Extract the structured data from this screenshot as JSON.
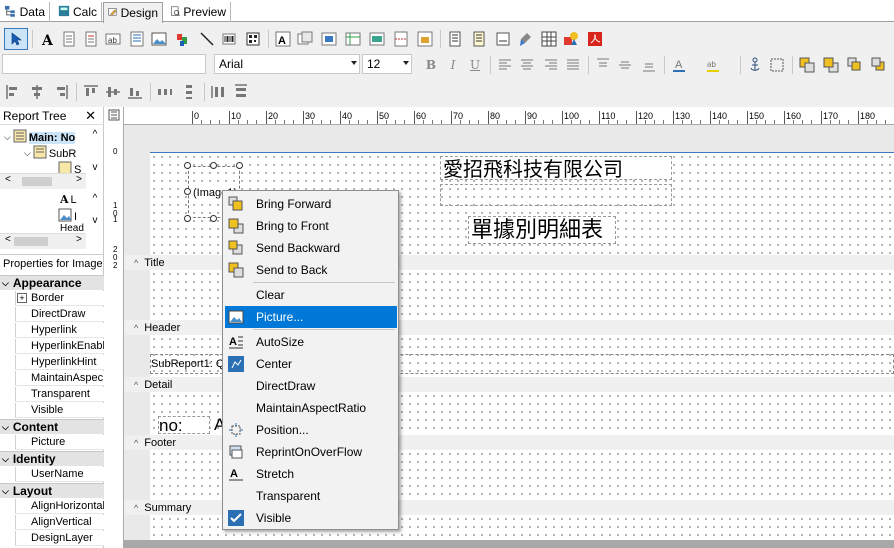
{
  "tabs": [
    {
      "label": "Data"
    },
    {
      "label": "Calc"
    },
    {
      "label": "Design"
    },
    {
      "label": "Preview"
    }
  ],
  "format_toolbar": {
    "font_name": "Arial",
    "font_size": "12"
  },
  "report_tree": {
    "title": "Report Tree",
    "items": [
      "Main: No",
      "SubR",
      "S",
      "L",
      "I",
      "Head"
    ]
  },
  "properties": {
    "title": "Properties for Image",
    "groups": [
      {
        "name": "Appearance",
        "items": [
          "Border",
          "DirectDraw",
          "Hyperlink",
          "HyperlinkEnabl",
          "HyperlinkHint",
          "MaintainAspec",
          "Transparent",
          "Visible"
        ]
      },
      {
        "name": "Content",
        "items": [
          "Picture"
        ]
      },
      {
        "name": "Identity",
        "items": [
          "UserName"
        ]
      },
      {
        "name": "Layout",
        "items": [
          "AlignHorizontal",
          "AlignVertical",
          "DesignLayer"
        ]
      }
    ]
  },
  "ruler_labels": [
    "0",
    "10",
    "20",
    "30",
    "40",
    "50",
    "60",
    "70",
    "80",
    "90",
    "100",
    "110",
    "120",
    "130",
    "140",
    "150",
    "160",
    "170",
    "180"
  ],
  "vruler_labels": [
    "0",
    "1",
    "0",
    "1",
    "2",
    "0",
    "2"
  ],
  "design": {
    "company_name": "愛招飛科技有限公司",
    "report_title": "單據別明細表",
    "image_placeholder": "(Image1)",
    "subreport_label": "SubReport1: Q",
    "detail_no_label": "no:",
    "detail_a_label": "A",
    "bands": {
      "title": "Title",
      "header": "Header",
      "detail": "Detail",
      "footer": "Footer",
      "summary": "Summary"
    }
  },
  "context_menu": {
    "items": [
      {
        "label": "Bring Forward",
        "icon": "bring-forward-icon"
      },
      {
        "label": "Bring to Front",
        "icon": "bring-to-front-icon"
      },
      {
        "label": "Send Backward",
        "icon": "send-backward-icon"
      },
      {
        "label": "Send to Back",
        "icon": "send-to-back-icon"
      },
      {
        "label": "Clear",
        "icon": ""
      },
      {
        "label": "Picture...",
        "icon": "picture-icon",
        "selected": true
      },
      {
        "label": "AutoSize",
        "icon": "autosize-icon"
      },
      {
        "label": "Center",
        "icon": "center-checked-icon"
      },
      {
        "label": "DirectDraw",
        "icon": ""
      },
      {
        "label": "MaintainAspectRatio",
        "icon": ""
      },
      {
        "label": "Position...",
        "icon": "position-icon"
      },
      {
        "label": "ReprintOnOverFlow",
        "icon": "reprint-icon"
      },
      {
        "label": "Stretch",
        "icon": "stretch-icon"
      },
      {
        "label": "Transparent",
        "icon": ""
      },
      {
        "label": "Visible",
        "icon": "visible-checked-icon"
      }
    ]
  },
  "colors": {
    "accent": "#0078d7",
    "surface": "#f0f0f0",
    "menu": "#f2f2f2"
  }
}
